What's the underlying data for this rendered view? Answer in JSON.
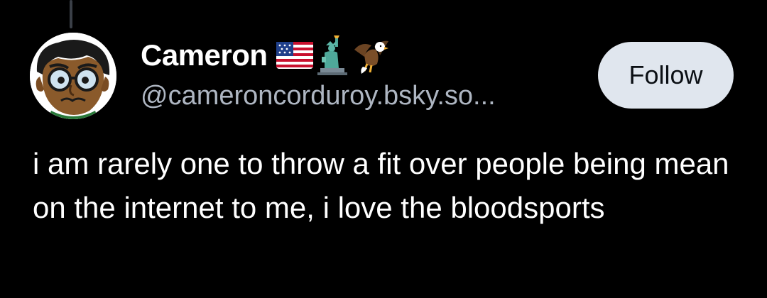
{
  "post": {
    "author": {
      "display_name": "Cameron",
      "handle": "@cameroncorduroy.bsky.so...",
      "flair_icons": [
        "us-flag-icon",
        "statue-of-liberty-icon",
        "eagle-icon"
      ]
    },
    "follow_label": "Follow",
    "text": "i am rarely one to throw a fit over people being mean on the internet to me, i love the bloodsports"
  },
  "colors": {
    "background": "#000000",
    "text": "#ffffff",
    "handle": "#aeb6c2",
    "follow_bg": "#e0e6ee",
    "follow_text": "#0b0f14"
  }
}
